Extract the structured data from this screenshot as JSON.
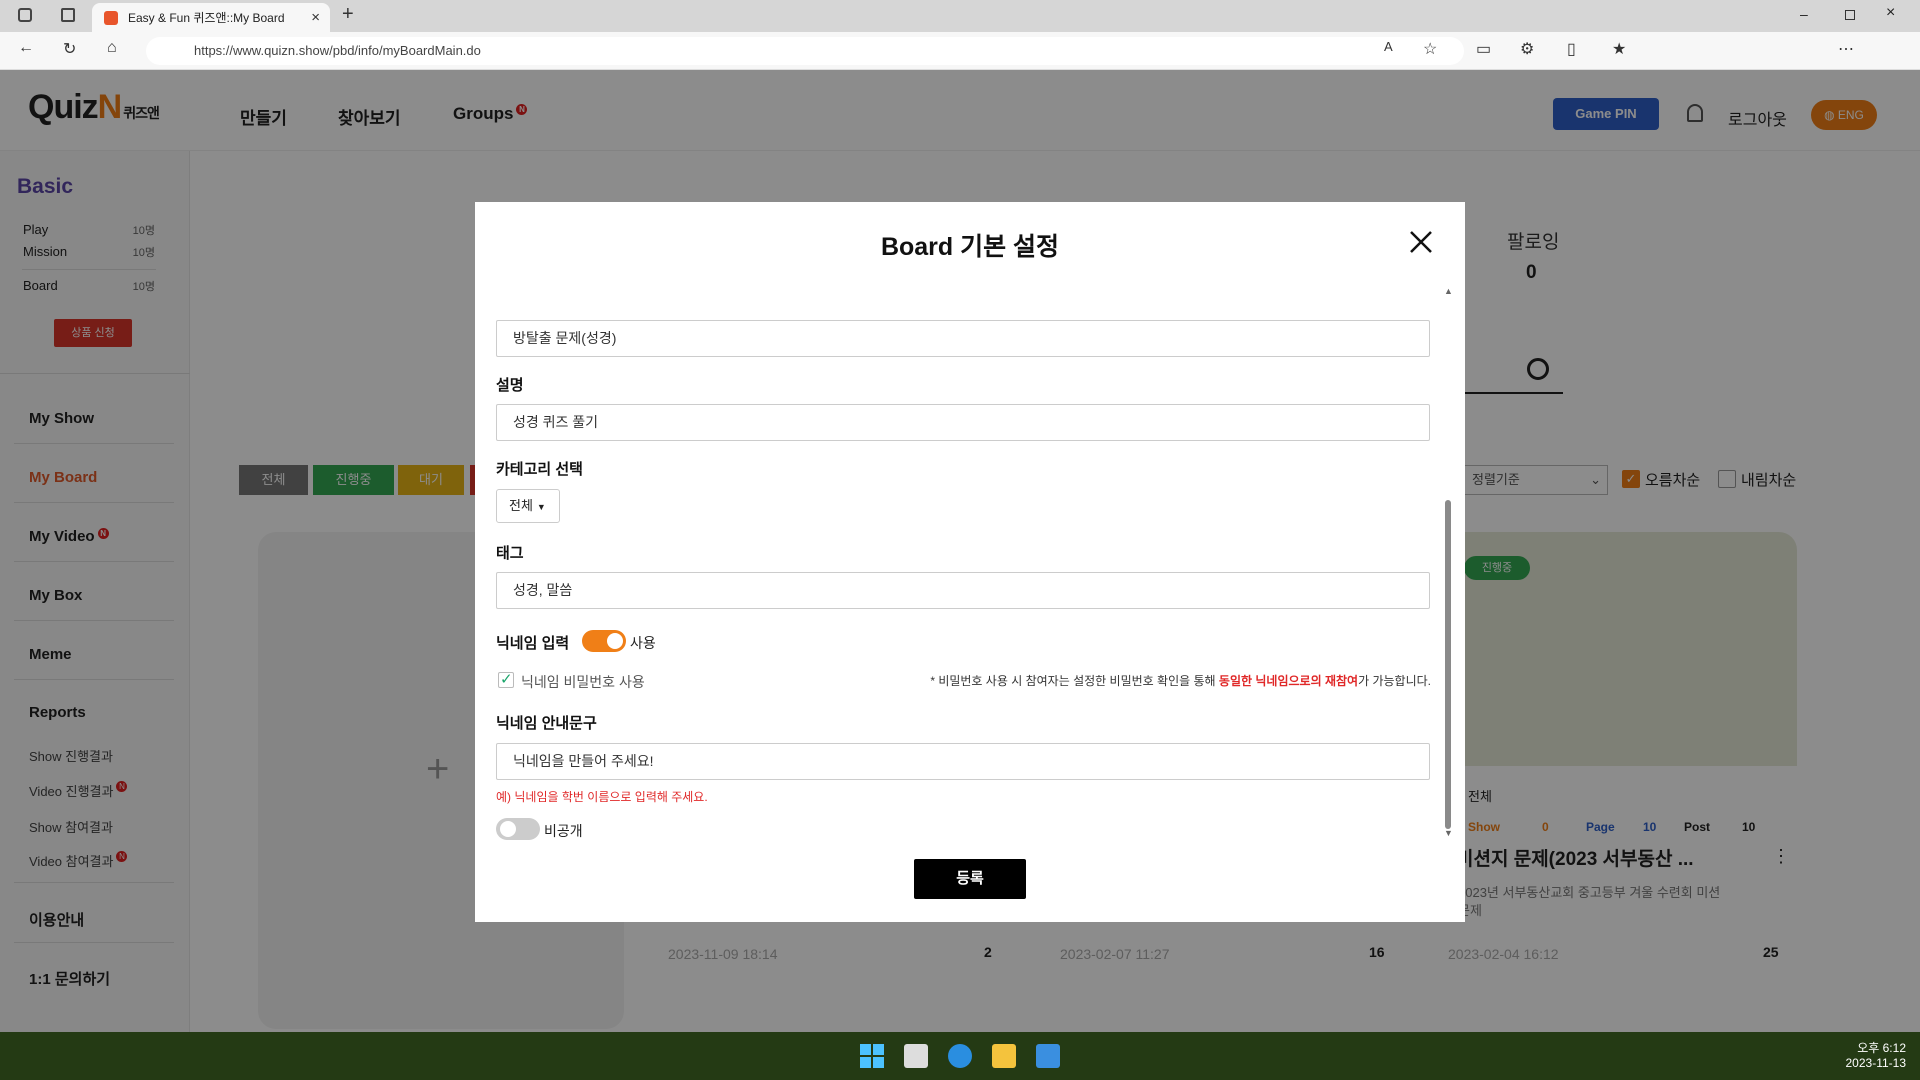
{
  "browser": {
    "tab_title": "Easy & Fun 퀴즈앤::My Board",
    "url": "https://www.quizn.show/pbd/info/myBoardMain.do"
  },
  "header": {
    "logo": "QuizN",
    "logo_sub": "퀴즈앤",
    "nav": [
      "만들기",
      "찾아보기",
      "Groups"
    ],
    "groups_badge": "N",
    "game_pin": "Game PIN",
    "logout": "로그아웃",
    "lang": "ENG"
  },
  "sidebar": {
    "plan": "Basic",
    "stats": [
      {
        "label": "Play",
        "value": "10명"
      },
      {
        "label": "Mission",
        "value": "10명"
      },
      {
        "label": "Board",
        "value": "10명"
      }
    ],
    "apply_button": "상품 신청",
    "menu": [
      "My Show",
      "My Board",
      "My Video",
      "My Box",
      "Meme",
      "Reports"
    ],
    "new_badge": "N",
    "reports_sub": [
      "Show 진행결과",
      "Video 진행결과",
      "Show 참여결과",
      "Video 참여결과"
    ],
    "bottom": [
      "이용안내",
      "1:1 문의하기"
    ]
  },
  "main": {
    "following_label": "팔로잉",
    "following_count": "0",
    "filters": [
      "전체",
      "진행중",
      "대기"
    ],
    "sort_placeholder": "정렬기준",
    "asc": "오름차순",
    "desc": "내림차순",
    "cards": [
      {
        "date": "2023-11-09 18:14",
        "count": "2"
      },
      {
        "date": "2023-02-07 11:27",
        "count": "16"
      },
      {
        "date": "2023-02-04 16:12",
        "count": "25",
        "status": "진행중",
        "category": "전체",
        "show": "0",
        "page": "10",
        "post": "10",
        "title": "미션지 문제(2023 서부동산 ...",
        "desc1": "2023년 서부동산교회 중고등부 겨울 수련회 미션",
        "desc2": "문제"
      }
    ],
    "card_stat_labels": [
      "Show",
      "Page",
      "Post"
    ]
  },
  "modal": {
    "title": "Board 기본 설정",
    "title_value": "방탈출 문제(성경)",
    "desc_label": "설명",
    "desc_value": "성경 퀴즈 풀기",
    "category_label": "카테고리 선택",
    "category_value": "전체",
    "tag_label": "태그",
    "tag_value": "성경, 말씀",
    "nickname_label": "닉네임 입력",
    "nickname_toggle": "사용",
    "pw_checkbox": "닉네임 비밀번호 사용",
    "note_a": "* 비밀번호 사용 시 참여자는 설정한 비밀번호 확인을 통해 ",
    "note_red": "동일한 닉네임으로의 재참여",
    "note_b": "가 가능합니다.",
    "guide_label": "닉네임 안내문구",
    "guide_value": "닉네임을 만들어 주세요!",
    "guide_hint": "예) 닉네임을 학번 이름으로 입력해 주세요.",
    "private_label": "비공개",
    "submit": "등록"
  },
  "taskbar": {
    "time": "오후 6:12",
    "date": "2023-11-13"
  },
  "colors": {
    "accent": "#f07f17",
    "primary": "#2e60c9",
    "toggle_on": "#f07f17",
    "red": "#e02828"
  }
}
